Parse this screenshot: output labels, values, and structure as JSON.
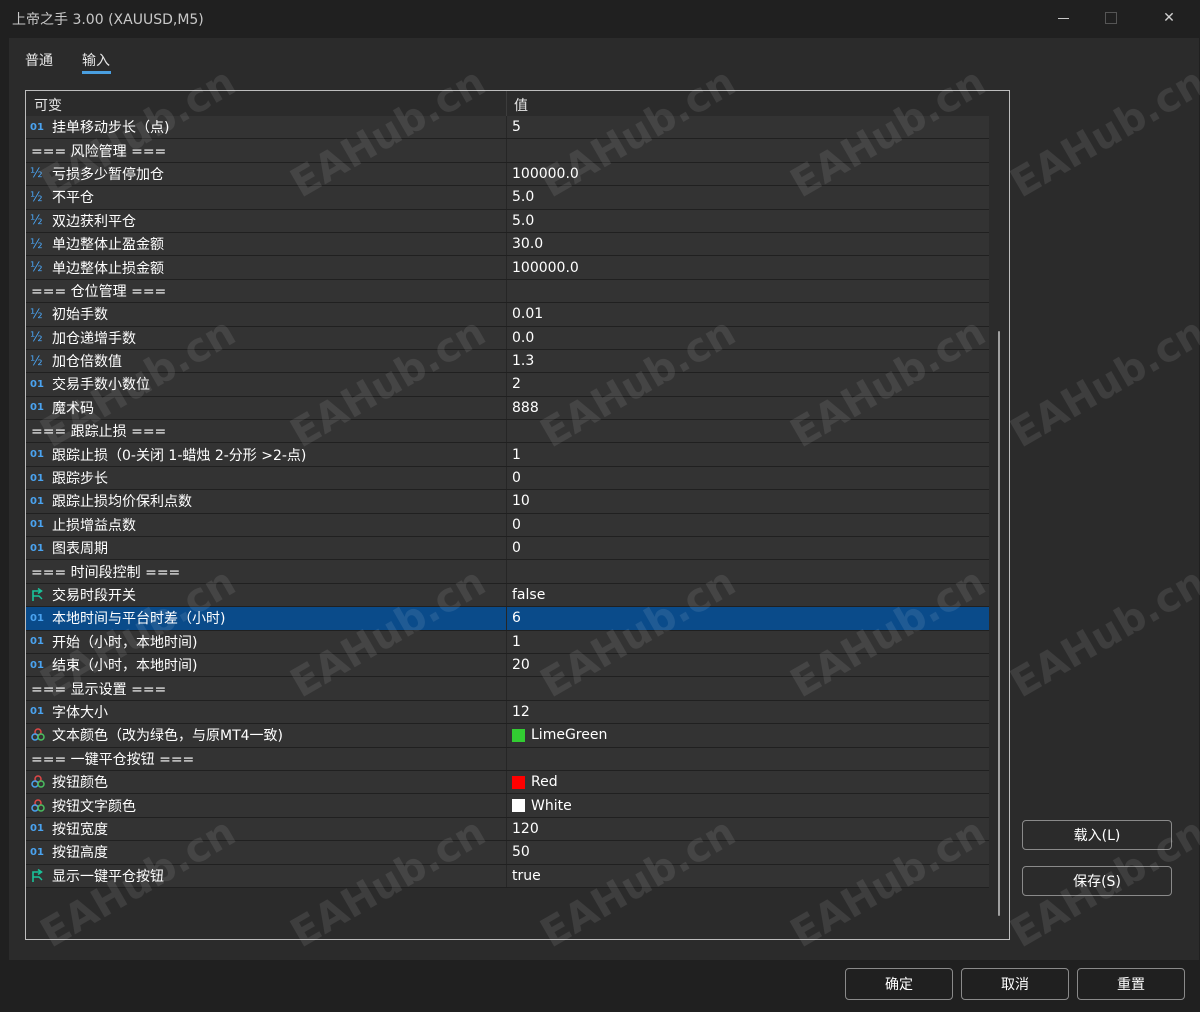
{
  "window": {
    "title": "上帝之手 3.00 (XAUUSD,M5)",
    "controls": {
      "close": "✕"
    }
  },
  "tabs": [
    {
      "label": "普通",
      "active": false
    },
    {
      "label": "输入",
      "active": true
    }
  ],
  "grid": {
    "columns": {
      "name": "可变",
      "value": "值"
    },
    "rows": [
      {
        "kind": "int",
        "icon": "01",
        "name": "挂单移动步长（点)",
        "value": "5"
      },
      {
        "kind": "sep",
        "name": "=== 风险管理 ==="
      },
      {
        "kind": "double",
        "icon": "½",
        "name": "亏损多少暂停加仓",
        "value": "100000.0"
      },
      {
        "kind": "double",
        "icon": "½",
        "name": "不平仓",
        "value": "5.0"
      },
      {
        "kind": "double",
        "icon": "½",
        "name": "双边获利平仓",
        "value": "5.0"
      },
      {
        "kind": "double",
        "icon": "½",
        "name": "单边整体止盈金额",
        "value": "30.0"
      },
      {
        "kind": "double",
        "icon": "½",
        "name": "单边整体止损金额",
        "value": "100000.0"
      },
      {
        "kind": "sep",
        "name": "=== 仓位管理 ==="
      },
      {
        "kind": "double",
        "icon": "½",
        "name": "初始手数",
        "value": "0.01"
      },
      {
        "kind": "double",
        "icon": "½",
        "name": "加仓递增手数",
        "value": "0.0"
      },
      {
        "kind": "double",
        "icon": "½",
        "name": "加仓倍数值",
        "value": "1.3"
      },
      {
        "kind": "int",
        "icon": "01",
        "name": "交易手数小数位",
        "value": "2"
      },
      {
        "kind": "int",
        "icon": "01",
        "name": "魔术码",
        "value": "888"
      },
      {
        "kind": "sep",
        "name": "=== 跟踪止损 ==="
      },
      {
        "kind": "int",
        "icon": "01",
        "name": "跟踪止损（0-关闭 1-蜡烛 2-分形 >2-点)",
        "value": "1"
      },
      {
        "kind": "int",
        "icon": "01",
        "name": "跟踪步长",
        "value": "0"
      },
      {
        "kind": "int",
        "icon": "01",
        "name": "跟踪止损均价保利点数",
        "value": "10"
      },
      {
        "kind": "int",
        "icon": "01",
        "name": "止损增益点数",
        "value": "0"
      },
      {
        "kind": "int",
        "icon": "01",
        "name": "图表周期",
        "value": "0"
      },
      {
        "kind": "sep",
        "name": "=== 时间段控制 ==="
      },
      {
        "kind": "bool",
        "icon": "bool-arrow",
        "name": "交易时段开关",
        "value": "false"
      },
      {
        "kind": "int",
        "icon": "01",
        "name": "本地时间与平台时差（小时)",
        "value": "6",
        "selected": true
      },
      {
        "kind": "int",
        "icon": "01",
        "name": "开始（小时，本地时间)",
        "value": "1"
      },
      {
        "kind": "int",
        "icon": "01",
        "name": "结束（小时，本地时间)",
        "value": "20"
      },
      {
        "kind": "sep",
        "name": "=== 显示设置 ==="
      },
      {
        "kind": "int",
        "icon": "01",
        "name": "字体大小",
        "value": "12"
      },
      {
        "kind": "color",
        "icon": "color-circles",
        "name": "文本颜色（改为绿色，与原MT4一致)",
        "value": "LimeGreen",
        "swatch": "#32cd32"
      },
      {
        "kind": "sep",
        "name": "=== 一键平仓按钮 ==="
      },
      {
        "kind": "color",
        "icon": "color-circles",
        "name": "按钮颜色",
        "value": "Red",
        "swatch": "#ff0000"
      },
      {
        "kind": "color",
        "icon": "color-circles",
        "name": "按钮文字颜色",
        "value": "White",
        "swatch": "#ffffff"
      },
      {
        "kind": "int",
        "icon": "01",
        "name": "按钮宽度",
        "value": "120"
      },
      {
        "kind": "int",
        "icon": "01",
        "name": "按钮高度",
        "value": "50"
      },
      {
        "kind": "bool",
        "icon": "bool-arrow",
        "name": "显示一键平仓按钮",
        "value": "true"
      }
    ]
  },
  "side_buttons": {
    "load": "载入(L)",
    "save": "保存(S)"
  },
  "footer": {
    "ok": "确定",
    "cancel": "取消",
    "reset": "重置"
  },
  "watermark": "EAHub.cn",
  "colors": {
    "selected_row": "#0a4b8a",
    "icon_blue": "#4aa3f0",
    "icon_green": "#19c39a"
  }
}
